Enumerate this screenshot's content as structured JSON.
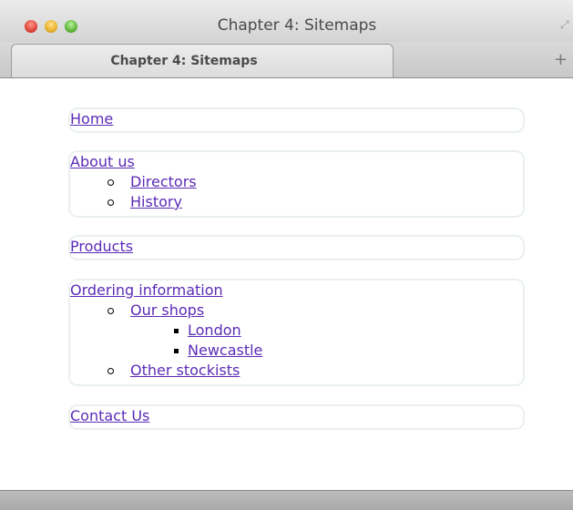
{
  "window": {
    "title": "Chapter 4: Sitemaps",
    "tab_label": "Chapter 4: Sitemaps",
    "new_tab_symbol": "+",
    "fullscreen_symbol": "⤢"
  },
  "sitemap": {
    "home": "Home",
    "about": {
      "label": "About us",
      "children": [
        "Directors",
        "History"
      ]
    },
    "products": "Products",
    "ordering": {
      "label": "Ordering information",
      "our_shops": "Our shops",
      "shops": [
        "London",
        "Newcastle"
      ],
      "other_stockists": "Other stockists"
    },
    "contact": "Contact Us"
  },
  "colors": {
    "link": "#5b2bb6",
    "box_border": "#eaf0f0"
  }
}
